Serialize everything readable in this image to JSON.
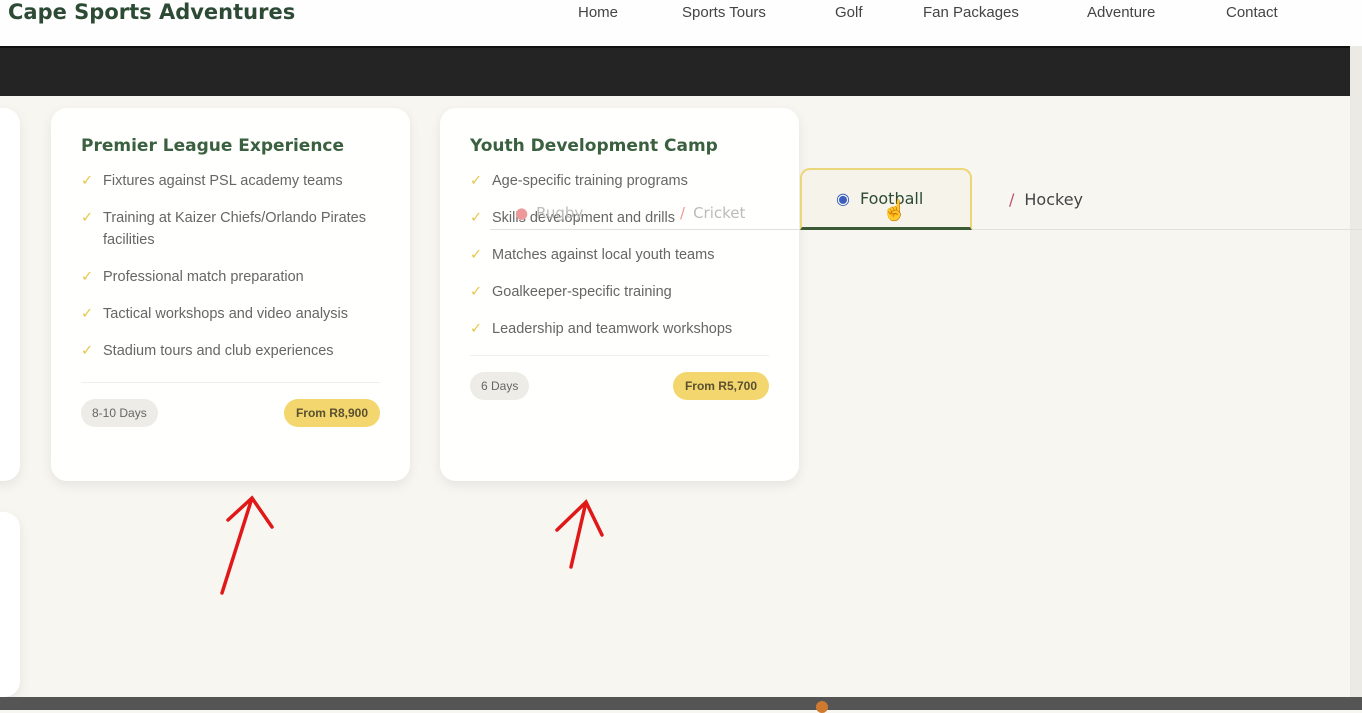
{
  "header": {
    "logo": "Cape Sports Adventures",
    "nav": [
      "Home",
      "Sports Tours",
      "Golf",
      "Fan Packages",
      "Adventure",
      "Contact"
    ]
  },
  "tabs": [
    {
      "label": "Rugby",
      "icon": "rugby-ball-icon"
    },
    {
      "label": "Cricket",
      "icon": "cricket-bat-icon"
    },
    {
      "label": "Football",
      "icon": "football-icon",
      "active": true
    },
    {
      "label": "Hockey",
      "icon": "hockey-stick-icon"
    }
  ],
  "cards": [
    {
      "title": "Premier League Experience",
      "features": [
        "Fixtures against PSL academy teams",
        "Training at Kaizer Chiefs/Orlando Pirates facilities",
        "Professional match preparation",
        "Tactical workshops and video analysis",
        "Stadium tours and club experiences"
      ],
      "duration": "8-10 Days",
      "price": "From R8,900"
    },
    {
      "title": "Youth Development Camp",
      "features": [
        "Age-specific training programs",
        "Skills development and drills",
        "Matches against local youth teams",
        "Goalkeeper-specific training",
        "Leadership and teamwork workshops"
      ],
      "duration": "6 Days",
      "price": "From R5,700"
    }
  ],
  "check": "✓",
  "accent": "#f3d76e"
}
